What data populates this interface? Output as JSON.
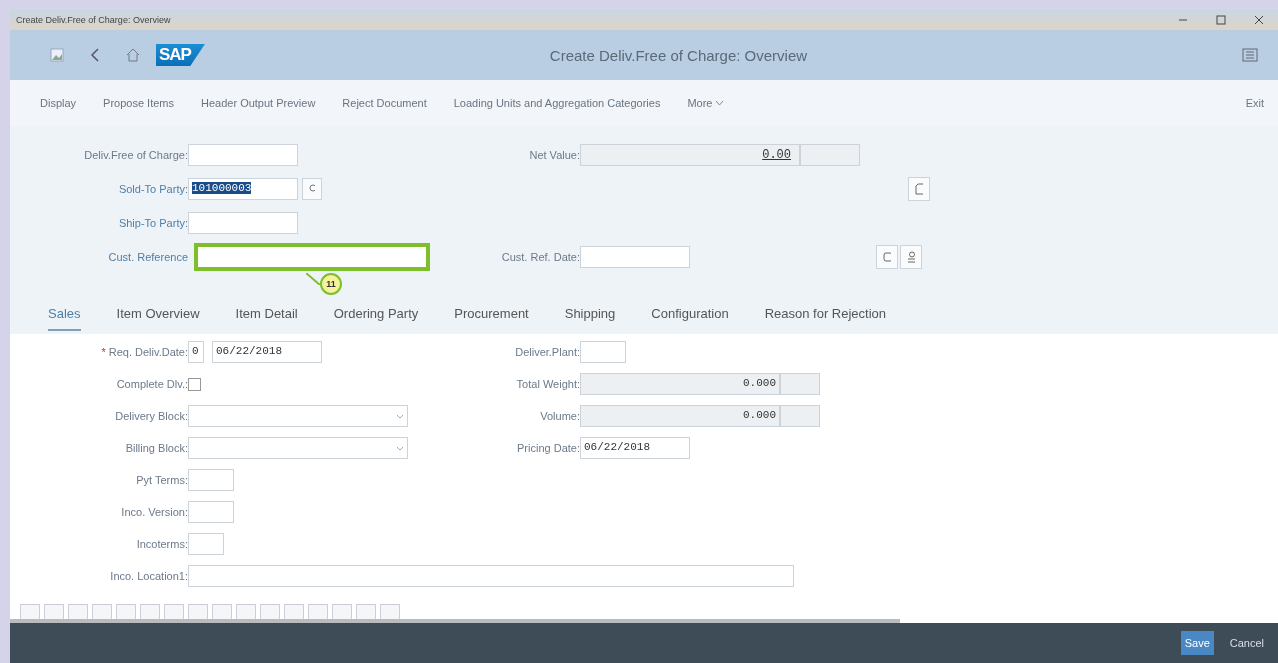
{
  "window": {
    "title": "Create Deliv.Free of Charge: Overview"
  },
  "shell": {
    "logo": "SAP",
    "title": "Create Deliv.Free of Charge: Overview"
  },
  "toolbar": {
    "items": [
      {
        "label": "Display"
      },
      {
        "label": "Propose Items"
      },
      {
        "label": "Header Output Preview"
      },
      {
        "label": "Reject Document"
      },
      {
        "label": "Loading Units and Aggregation Categories"
      }
    ],
    "more": "More",
    "exit": "Exit"
  },
  "header": {
    "fields": [
      {
        "label": "Deliv.Free of Charge:",
        "kind": "input",
        "highlighted": false
      },
      {
        "label": "Sold-To Party:",
        "kind": "lookup",
        "value": "101000003",
        "selected": true,
        "highlighted": false
      },
      {
        "label": "Ship-To Party:",
        "kind": "input",
        "highlighted": false
      },
      {
        "label": "Cust. Reference",
        "kind": "wide",
        "highlighted": true
      }
    ],
    "net_value": {
      "label": "Net Value:",
      "value": "0.00"
    },
    "ref_date": {
      "label": "Cust. Ref. Date:"
    },
    "callout": "11"
  },
  "tabs": [
    {
      "label": "Sales",
      "selected": true
    },
    {
      "label": "Item Overview",
      "selected": false
    },
    {
      "label": "Item Detail",
      "selected": false
    },
    {
      "label": "Ordering Party",
      "selected": false
    },
    {
      "label": "Procurement",
      "selected": false
    },
    {
      "label": "Shipping",
      "selected": false
    },
    {
      "label": "Configuration",
      "selected": false
    },
    {
      "label": "Reason for Rejection",
      "selected": false
    }
  ],
  "sales": {
    "left": [
      {
        "label": "Req. Deliv.Date:",
        "required_mark": "*",
        "kind": "date",
        "code": "0",
        "value": "06/22/2018"
      },
      {
        "label": "Complete Dlv.:",
        "kind": "checkbox",
        "checked": false
      },
      {
        "label": "Delivery Block:",
        "kind": "dropdown"
      },
      {
        "label": "Billing Block:",
        "kind": "dropdown"
      },
      {
        "label": "Pyt Terms:",
        "kind": "small"
      },
      {
        "label": "Inco. Version:",
        "kind": "small"
      },
      {
        "label": "Incoterms:",
        "kind": "tiny"
      },
      {
        "label": "Inco. Location1:",
        "kind": "long"
      }
    ],
    "right": [
      {
        "label": "Deliver.Plant:",
        "kind": "small"
      },
      {
        "label": "Total Weight:",
        "kind": "readonly",
        "value": "0.000"
      },
      {
        "label": "Volume:",
        "kind": "readonly",
        "value": "0.000"
      },
      {
        "label": "Pricing Date:",
        "kind": "date",
        "value": "06/22/2018"
      }
    ]
  },
  "footer": {
    "buttons": [
      {
        "label": "Save",
        "kind": "primary"
      },
      {
        "label": "Cancel",
        "kind": "plain"
      }
    ]
  }
}
